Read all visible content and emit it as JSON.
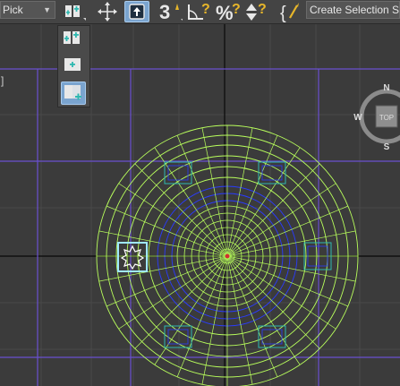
{
  "toolbar": {
    "pick_dropdown": {
      "value": "Pick"
    },
    "create_selection_set": {
      "value": "Create Selection Se"
    },
    "buttons": [
      {
        "name": "select-object",
        "icon": "select-object-icon"
      },
      {
        "name": "move",
        "icon": "move-icon"
      },
      {
        "name": "select-and-place",
        "icon": "select-and-place-icon",
        "active": true
      },
      {
        "name": "snaps-toggle",
        "icon": "snaps-3d-icon",
        "label": "3"
      },
      {
        "name": "angle-snap",
        "icon": "angle-snap-icon"
      },
      {
        "name": "percent-snap",
        "icon": "percent-snap-icon",
        "label": "%"
      },
      {
        "name": "spinner-snap",
        "icon": "spinner-snap-icon"
      },
      {
        "name": "edit-named-selection",
        "icon": "edit-named-selection-icon"
      }
    ]
  },
  "flyout": {
    "items": [
      {
        "name": "use-pivot-point-center",
        "icon": "pivot-center-icon"
      },
      {
        "name": "use-selection-center",
        "icon": "selection-center-icon"
      },
      {
        "name": "use-transform-coordinate-center",
        "icon": "transform-center-icon",
        "active": true
      }
    ]
  },
  "viewport": {
    "label": "]",
    "viewcube": {
      "north": "N",
      "south": "S",
      "west": "W",
      "face": "TOP"
    }
  },
  "colors": {
    "background": "#3b3b3b",
    "grid": "#4a4a4a",
    "grid_major": "#6a4fd0",
    "wireframe": "#b9ff5c",
    "wire_blue": "#2a3cff",
    "selected_object": "#9fe8ff",
    "accent": "#7aa4cf"
  }
}
